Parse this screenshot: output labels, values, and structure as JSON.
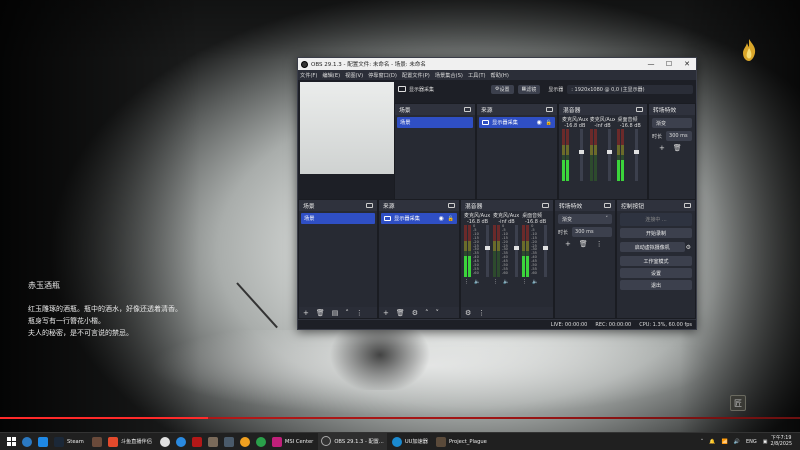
{
  "game": {
    "lore_title": "赤玉酒瓶",
    "lore_lines": [
      "红玉雕琢的酒瓶。瓶中的酒水，好像还透着清香。",
      "瓶身写有一行簪花小楷。",
      "夫人的秘密，是不可言说的禁忌。"
    ],
    "progress_fraction": 0.26,
    "corner_glyph": "匠"
  },
  "obs": {
    "title": "OBS 29.1.3 - 配置文件: 未命名 - 场景: 未命名",
    "window_controls": [
      "—",
      "☐",
      "✕"
    ],
    "menu": [
      "文件(F)",
      "编辑(E)",
      "视图(V)",
      "停靠窗口(D)",
      "配置文件(P)",
      "场景集合(S)",
      "工具(T)",
      "帮助(H)"
    ],
    "source_toolbar": {
      "source_name": "显示器采集",
      "settings_label": "设置",
      "filters_label": "滤镜",
      "display_label": "显示器",
      "display_value": ": 1920x1080 @ 0,0 (主显示器)"
    },
    "scenes": {
      "title": "场景",
      "items": [
        "场景"
      ]
    },
    "sources": {
      "title": "来源",
      "items": [
        "显示器采集"
      ]
    },
    "mixer": {
      "title": "混音器",
      "channels": [
        {
          "name": "麦克风/Aux",
          "db": "-16.8 dB"
        },
        {
          "name": "麦克风/Aux 2",
          "db": "-inf dB"
        },
        {
          "name": "桌面音频",
          "db": "-16.8 dB"
        }
      ],
      "scale": [
        "0",
        "-5",
        "-10",
        "-15",
        "-20",
        "-25",
        "-30",
        "-35",
        "-40",
        "-45",
        "-50",
        "-55",
        "-60"
      ]
    },
    "transitions": {
      "title": "转场特效",
      "type": "渐变",
      "duration_label": "时长",
      "duration_value": "300 ms"
    },
    "controls": {
      "title": "控制按钮",
      "buttons": [
        "连接中 ...",
        "开始录制",
        "启动虚拟摄像机",
        "工作室模式",
        "设置",
        "退出"
      ]
    },
    "status": {
      "live": "LIVE: 00:00:00",
      "rec": "REC: 00:00:00",
      "cpu": "CPU: 1.3%, 60.00 fps"
    }
  },
  "taskbar": {
    "apps": [
      "Steam",
      "斗鱼直播伴侣",
      "MSI Center",
      "OBS 29.1.3 - 配置...",
      "UU加速器",
      "Project_Plague"
    ],
    "tray_lang": "ENG",
    "time": "下午7:19",
    "date": "2/8/2025"
  },
  "colors": {
    "obs_bg": "#1d1f26",
    "dock_bg": "#272a33",
    "selection": "#2f4fc4",
    "meter_green": "#3bd43b",
    "red_bar": "#b31818"
  }
}
